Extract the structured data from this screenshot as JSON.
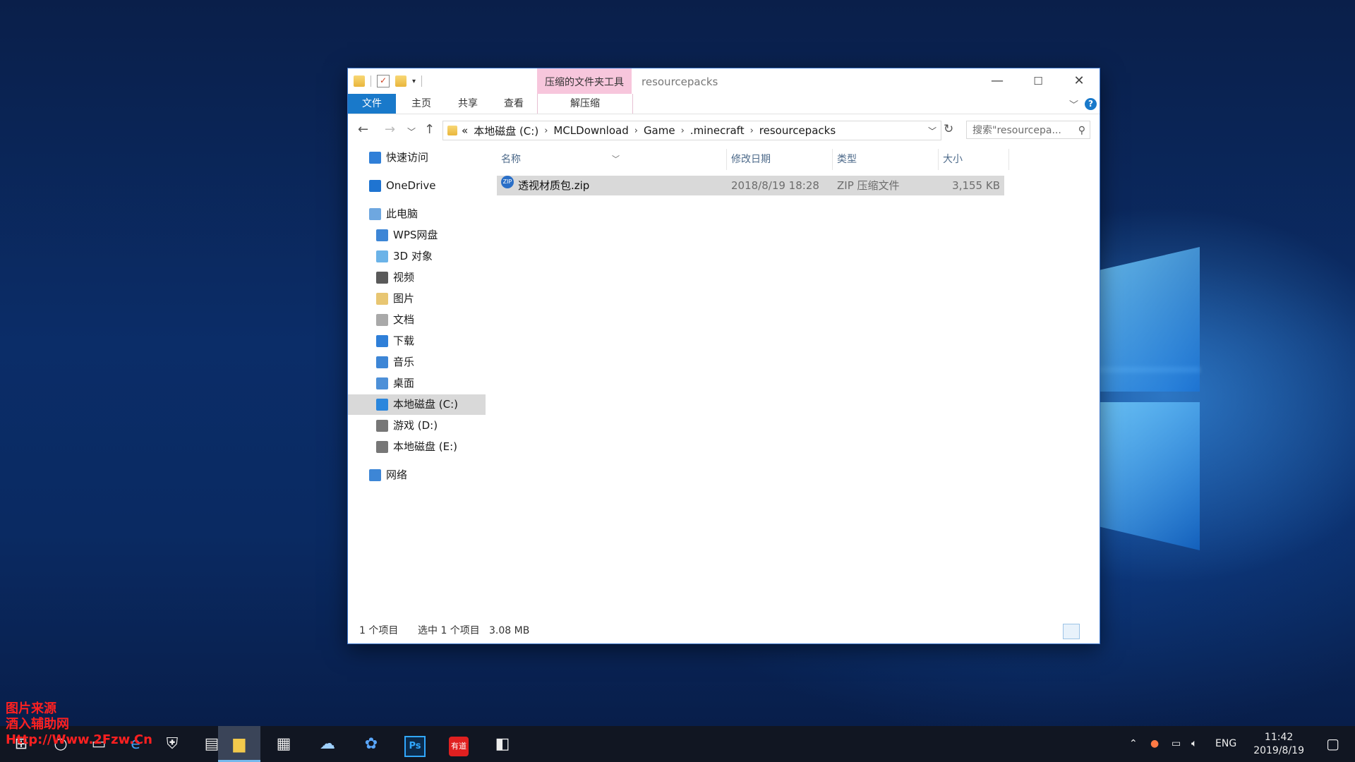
{
  "window": {
    "title": "resourcepacks",
    "ribbon": {
      "context_group_label": "压缩的文件夹工具",
      "tabs": [
        "文件",
        "主页",
        "共享",
        "查看",
        "解压缩"
      ]
    },
    "address": {
      "prefix": "«",
      "crumbs": [
        "本地磁盘 (C:)",
        "MCLDownload",
        "Game",
        ".minecraft",
        "resourcepacks"
      ]
    },
    "search": {
      "placeholder": "搜索\"resourcepa..."
    },
    "sidebar": [
      {
        "label": "快速访问",
        "icon": "star-icon",
        "color": "#2f7fd8"
      },
      {
        "label": "OneDrive",
        "icon": "cloud-icon",
        "color": "#1f74d1"
      },
      {
        "label": "此电脑",
        "icon": "computer-icon",
        "color": "#6ea7e0"
      },
      {
        "label": "WPS网盘",
        "icon": "cloud-outline-icon",
        "color": "#3d86d6"
      },
      {
        "label": "3D 对象",
        "icon": "cube-icon",
        "color": "#6bb3e8"
      },
      {
        "label": "视频",
        "icon": "video-icon",
        "color": "#5a5a5a"
      },
      {
        "label": "图片",
        "icon": "picture-icon",
        "color": "#e8c672"
      },
      {
        "label": "文档",
        "icon": "document-icon",
        "color": "#a9a9a9"
      },
      {
        "label": "下载",
        "icon": "download-icon",
        "color": "#2f7fd8"
      },
      {
        "label": "音乐",
        "icon": "music-icon",
        "color": "#3d86d6"
      },
      {
        "label": "桌面",
        "icon": "desktop-icon",
        "color": "#4d90d8"
      },
      {
        "label": "本地磁盘 (C:)",
        "icon": "drive-windows-icon",
        "color": "#2a86dd",
        "selected": true
      },
      {
        "label": "游戏 (D:)",
        "icon": "drive-icon",
        "color": "#777777"
      },
      {
        "label": "本地磁盘 (E:)",
        "icon": "drive-icon",
        "color": "#777777"
      },
      {
        "label": "网络",
        "icon": "network-icon",
        "color": "#3d86d6"
      }
    ],
    "columns": [
      "名称",
      "修改日期",
      "类型",
      "大小"
    ],
    "files": [
      {
        "name": "透视材质包.zip",
        "modified": "2018/8/19 18:28",
        "type": "ZIP 压缩文件",
        "size": "3,155 KB"
      }
    ],
    "status": {
      "count": "1 个项目",
      "selected": "选中 1 个项目",
      "selected_size": "3.08 MB"
    }
  },
  "taskbar": {
    "apps": [
      "start-icon",
      "search-icon",
      "task-view-icon",
      "edge-icon",
      "security-icon",
      "photos-icon",
      "file-explorer-icon",
      "store-icon",
      "cloud-app-icon",
      "baidu-netdisk-icon",
      "photoshop-icon",
      "youdao-icon",
      "app-icon"
    ],
    "photoshop_label": "Ps",
    "youdao_label": "有道",
    "language": "ENG",
    "time": "11:42",
    "date": "2019/8/19"
  },
  "watermark": [
    "图片来源",
    "酒入辅助网",
    "Http://Www.2Fzw.Cn"
  ]
}
